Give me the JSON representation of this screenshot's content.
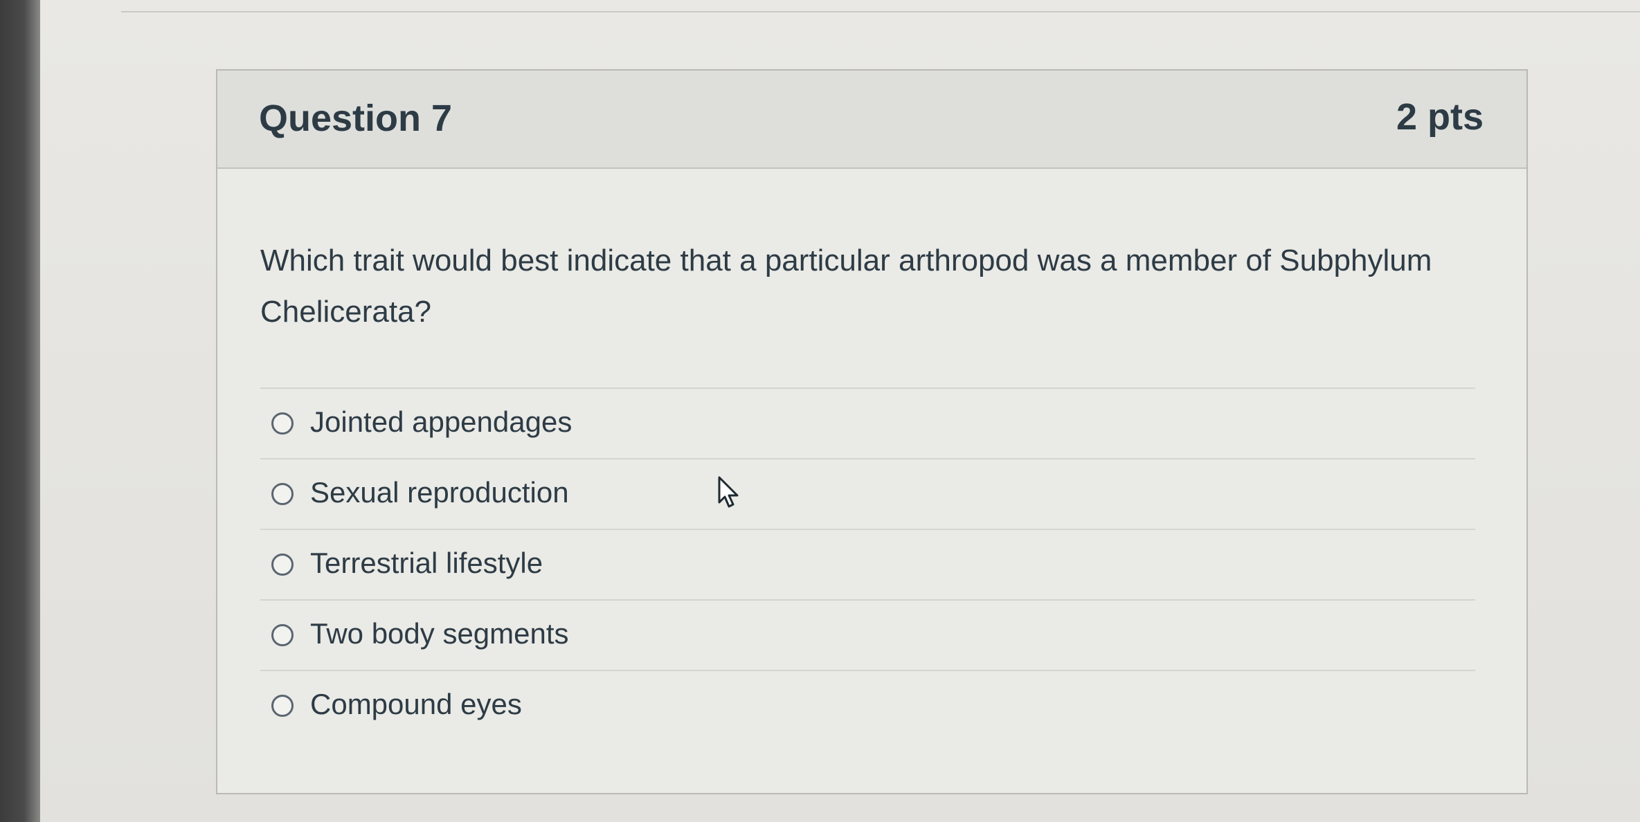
{
  "question": {
    "title": "Question 7",
    "points": "2 pts",
    "text": "Which trait would best indicate that a particular arthropod was a member of Subphylum Chelicerata?"
  },
  "answers": [
    {
      "label": "Jointed appendages"
    },
    {
      "label": "Sexual reproduction"
    },
    {
      "label": "Terrestrial lifestyle"
    },
    {
      "label": "Two body segments"
    },
    {
      "label": "Compound eyes"
    }
  ],
  "icons": {
    "radio": "radio-unselected-icon",
    "cursor": "mouse-pointer-icon"
  },
  "colors": {
    "text": "#2d3b45",
    "header_bg": "#dedfdb",
    "border": "#b9b9b6"
  }
}
